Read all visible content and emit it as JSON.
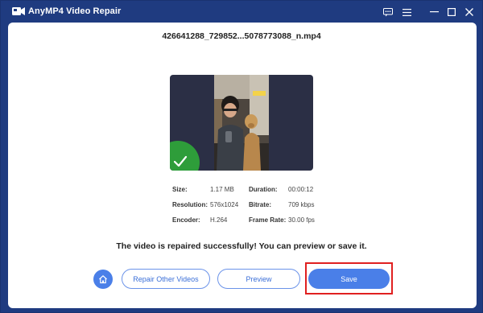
{
  "window": {
    "title": "AnyMP4 Video Repair",
    "controls": [
      "feedback-icon",
      "menu-icon",
      "minimize-icon",
      "maximize-icon",
      "close-icon"
    ]
  },
  "file": {
    "name": "426641288_729852...5078773088_n.mp4"
  },
  "info": {
    "size_label": "Size:",
    "size_value": "1.17 MB",
    "duration_label": "Duration:",
    "duration_value": "00:00:12",
    "resolution_label": "Resolution:",
    "resolution_value": "576x1024",
    "bitrate_label": "Bitrate:",
    "bitrate_value": "709 kbps",
    "encoder_label": "Encoder:",
    "encoder_value": "H.264",
    "framerate_label": "Frame Rate:",
    "framerate_value": "30.00 fps"
  },
  "status": {
    "message": "The video is repaired successfully! You can preview or save it."
  },
  "actions": {
    "repair_other_label": "Repair Other Videos",
    "preview_label": "Preview",
    "save_label": "Save"
  },
  "colors": {
    "frame": "#1f3b80",
    "accent": "#4a7fe8",
    "success": "#2e9d3a",
    "highlight": "#e02020"
  }
}
